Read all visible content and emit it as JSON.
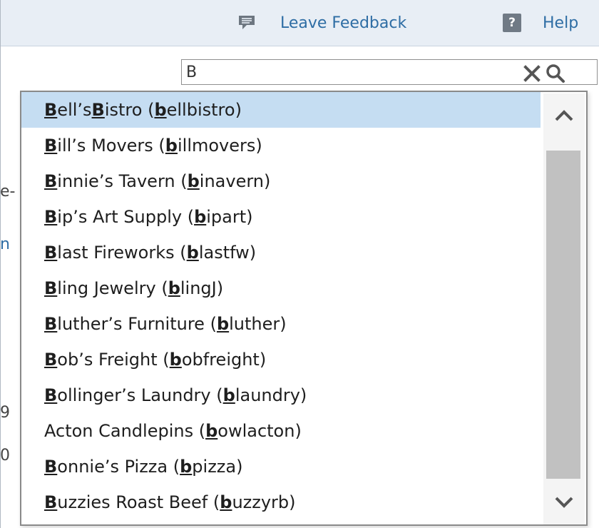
{
  "header": {
    "feedback_label": "Leave Feedback",
    "help_label": "Help",
    "help_icon_glyph": "?"
  },
  "left_fragments": [
    "e-",
    "n",
    "9",
    "0"
  ],
  "search": {
    "value": "B",
    "placeholder": ""
  },
  "dropdown": {
    "items": [
      {
        "parts": [
          {
            "t": "B",
            "b": true
          },
          {
            "t": "ell’s "
          },
          {
            "t": "B",
            "b": true
          },
          {
            "t": "istro ("
          },
          {
            "t": "b",
            "b": true
          },
          {
            "t": "ellbistro)"
          }
        ],
        "selected": true
      },
      {
        "parts": [
          {
            "t": "B",
            "b": true
          },
          {
            "t": "ill’s Movers ("
          },
          {
            "t": "b",
            "b": true
          },
          {
            "t": "illmovers)"
          }
        ]
      },
      {
        "parts": [
          {
            "t": "B",
            "b": true
          },
          {
            "t": "innie’s Tavern ("
          },
          {
            "t": "b",
            "b": true
          },
          {
            "t": "inavern)"
          }
        ]
      },
      {
        "parts": [
          {
            "t": "B",
            "b": true
          },
          {
            "t": "ip’s Art Supply ("
          },
          {
            "t": "b",
            "b": true
          },
          {
            "t": "ipart)"
          }
        ]
      },
      {
        "parts": [
          {
            "t": "B",
            "b": true
          },
          {
            "t": "last Fireworks ("
          },
          {
            "t": "b",
            "b": true
          },
          {
            "t": "lastfw)"
          }
        ]
      },
      {
        "parts": [
          {
            "t": "B",
            "b": true
          },
          {
            "t": "ling Jewelry ("
          },
          {
            "t": "b",
            "b": true
          },
          {
            "t": "lingJ)"
          }
        ]
      },
      {
        "parts": [
          {
            "t": "B",
            "b": true
          },
          {
            "t": "luther’s Furniture ("
          },
          {
            "t": "b",
            "b": true
          },
          {
            "t": "luther)"
          }
        ]
      },
      {
        "parts": [
          {
            "t": "B",
            "b": true
          },
          {
            "t": "ob’s Freight ("
          },
          {
            "t": "b",
            "b": true
          },
          {
            "t": "obfreight)"
          }
        ]
      },
      {
        "parts": [
          {
            "t": "B",
            "b": true
          },
          {
            "t": "ollinger’s Laundry ("
          },
          {
            "t": "b",
            "b": true
          },
          {
            "t": "laundry)"
          }
        ]
      },
      {
        "parts": [
          {
            "t": "Acton Candlepins ("
          },
          {
            "t": "b",
            "b": true
          },
          {
            "t": "owlacton)"
          }
        ]
      },
      {
        "parts": [
          {
            "t": "B",
            "b": true
          },
          {
            "t": "onnie’s Pizza ("
          },
          {
            "t": "b",
            "b": true
          },
          {
            "t": "pizza)"
          }
        ]
      },
      {
        "parts": [
          {
            "t": "B",
            "b": true
          },
          {
            "t": "uzzies Roast Beef ("
          },
          {
            "t": "b",
            "b": true
          },
          {
            "t": "uzzyrb)"
          }
        ]
      }
    ]
  },
  "colors": {
    "link": "#2e6da4",
    "selected_row": "#c5ddf2",
    "topbar_bg": "#e8eef5"
  },
  "icons": [
    "speech-bubble-icon",
    "help-icon",
    "clear-icon",
    "search-icon",
    "chevron-up-icon",
    "chevron-down-icon"
  ]
}
